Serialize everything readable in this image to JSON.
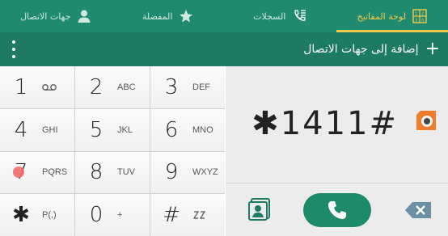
{
  "tabs": [
    {
      "label": "لوحة المفاتيح",
      "icon": "dialpad-icon",
      "active": true
    },
    {
      "label": "السجلات",
      "icon": "call-log-icon",
      "active": false
    },
    {
      "label": "المفضلة",
      "icon": "star-icon",
      "active": false
    },
    {
      "label": "جهات الاتصال",
      "icon": "person-icon",
      "active": false
    }
  ],
  "actionbar": {
    "plus": "+",
    "add_label": "إضافة إلى جهات الاتصال"
  },
  "keys": [
    {
      "digit": "1",
      "letters": "",
      "sub_icon": "voicemail-icon"
    },
    {
      "digit": "2",
      "letters": "ABC"
    },
    {
      "digit": "3",
      "letters": "DEF"
    },
    {
      "digit": "4",
      "letters": "GHI"
    },
    {
      "digit": "5",
      "letters": "JKL"
    },
    {
      "digit": "6",
      "letters": "MNO"
    },
    {
      "digit": "7",
      "letters": "PQRS"
    },
    {
      "digit": "8",
      "letters": "TUV"
    },
    {
      "digit": "9",
      "letters": "WXYZ"
    },
    {
      "digit": "✱",
      "letters": "P(,)"
    },
    {
      "digit": "0",
      "letters": "+"
    },
    {
      "digit": "#",
      "letters": "",
      "sub_icon": "wait-icon"
    }
  ],
  "display": {
    "number": "✱1411#"
  },
  "colors": {
    "tabbar": "#1f8a70",
    "actionbar": "#1d7a63",
    "accent": "#f4c84a",
    "call": "#1d8a6a",
    "app_badge": "#f07b2a"
  }
}
